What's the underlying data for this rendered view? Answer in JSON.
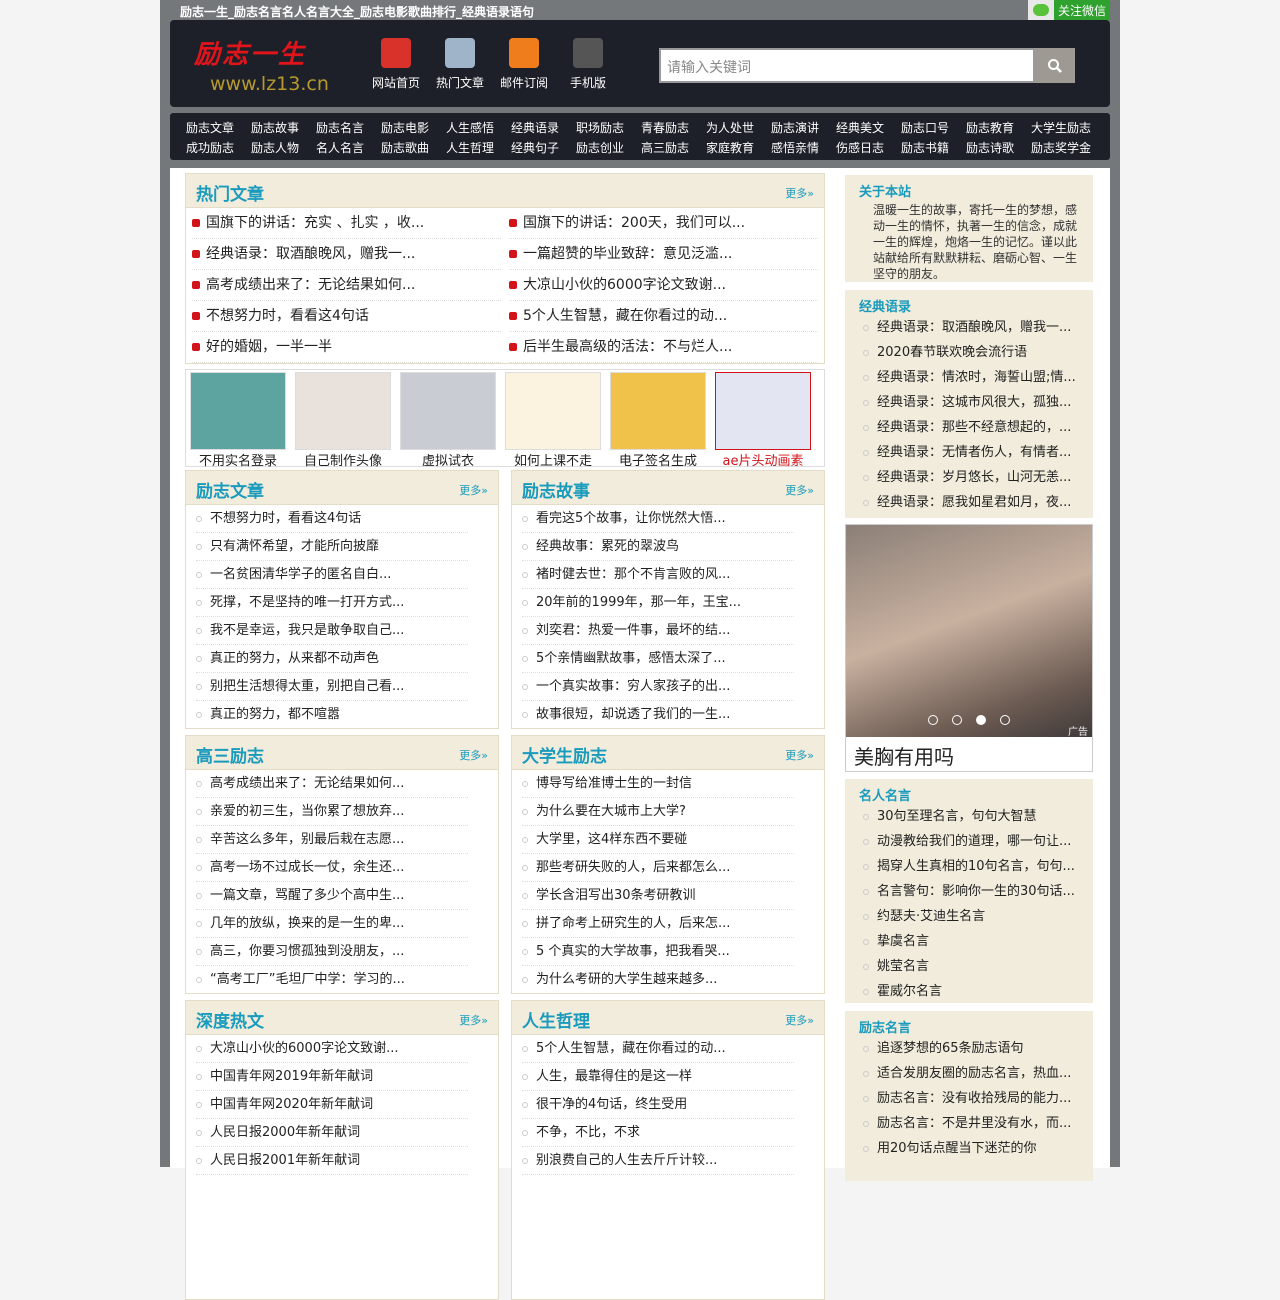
{
  "site_title": "励志一生_励志名言名人名言大全_励志电影歌曲排行_经典语录语句",
  "wechat": "关注微信",
  "logo": {
    "cn": "励志一生",
    "url": "www.lz13.cn"
  },
  "header_nav": [
    {
      "label": "网站首页",
      "icon": "home-icon",
      "color": "#d8322a"
    },
    {
      "label": "热门文章",
      "icon": "document-globe-icon",
      "color": "#9fb4c8"
    },
    {
      "label": "邮件订阅",
      "icon": "rss-icon",
      "color": "#f07d1c"
    },
    {
      "label": "手机版",
      "icon": "mobile-phone-icon",
      "color": "#555"
    }
  ],
  "search": {
    "placeholder": "请输入关键词"
  },
  "nav": [
    [
      "励志文章",
      "励志故事",
      "励志名言",
      "励志电影",
      "人生感悟",
      "经典语录",
      "职场励志",
      "青春励志",
      "为人处世",
      "励志演讲",
      "经典美文",
      "励志口号",
      "励志教育",
      "大学生励志"
    ],
    [
      "成功励志",
      "励志人物",
      "名人名言",
      "励志歌曲",
      "人生哲理",
      "经典句子",
      "励志创业",
      "高三励志",
      "家庭教育",
      "感悟亲情",
      "伤感日志",
      "励志书籍",
      "励志诗歌",
      "励志奖学金"
    ]
  ],
  "more": "更多»",
  "hot": {
    "title": "热门文章",
    "items": [
      "国旗下的讲话：充实 、扎实 ，收...",
      "国旗下的讲话：200天，我们可以...",
      "经典语录：取酒酿晚风，赠我一...",
      "一篇超赞的毕业致辞：意见泛滥...",
      "高考成绩出来了：无论结果如何...",
      "大凉山小伙的6000字论文致谢...",
      "不想努力时，看看这4句话",
      "5个人生智慧，藏在你看过的动...",
      "好的婚姻，一半一半",
      "后半生最高级的活法：不与烂人..."
    ]
  },
  "thumbs": [
    {
      "label": "不用实名登录",
      "color": "#5da3a0"
    },
    {
      "label": "自己制作头像",
      "color": "#e9e2dc"
    },
    {
      "label": "虚拟试衣",
      "color": "#c9cdd3"
    },
    {
      "label": "如何上课不走",
      "color": "#fbf3df"
    },
    {
      "label": "电子签名生成",
      "color": "#f0c24a"
    },
    {
      "label": "ae片头动画素",
      "color": "#e3e6f2"
    }
  ],
  "sections": [
    {
      "title": "励志文章",
      "items": [
        "不想努力时，看看这4句话",
        "只有满怀希望，才能所向披靡",
        "一名贫困清华学子的匿名自白...",
        "死撑，不是坚持的唯一打开方式...",
        "我不是幸运，我只是敢争取自己...",
        "真正的努力，从来都不动声色",
        "别把生活想得太重，别把自己看...",
        "真正的努力，都不喧嚣"
      ]
    },
    {
      "title": "励志故事",
      "items": [
        "看完这5个故事，让你恍然大悟...",
        "经典故事：累死的翠波鸟",
        "褚时健去世：那个不肯言败的风...",
        "20年前的1999年，那一年，王宝...",
        "刘奕君：热爱一件事，最坏的结...",
        "5个亲情幽默故事，感悟太深了...",
        "一个真实故事：穷人家孩子的出...",
        "故事很短，却说透了我们的一生..."
      ]
    },
    {
      "title": "高三励志",
      "items": [
        "高考成绩出来了：无论结果如何...",
        "亲爱的初三生，当你累了想放弃...",
        "辛苦这么多年，别最后栽在志愿...",
        "高考一场不过成长一仗，余生还...",
        "一篇文章，骂醒了多少个高中生...",
        "几年的放纵，换来的是一生的卑...",
        "高三，你要习惯孤独到没朋友，...",
        "“高考工厂”毛坦厂中学：学习的..."
      ]
    },
    {
      "title": "大学生励志",
      "items": [
        "博导写给准博士生的一封信",
        "为什么要在大城市上大学?",
        "大学里，这4样东西不要碰",
        "那些考研失败的人，后来都怎么...",
        "学长含泪写出30条考研教训",
        "拼了命考上研究生的人，后来怎...",
        "5 个真实的大学故事，把我看哭...",
        "为什么考研的大学生越来越多..."
      ]
    },
    {
      "title": "深度热文",
      "items": [
        "大凉山小伙的6000字论文致谢...",
        "中国青年网2019年新年献词",
        "中国青年网2020年新年献词",
        "人民日报2000年新年献词",
        "人民日报2001年新年献词"
      ]
    },
    {
      "title": "人生哲理",
      "items": [
        "5个人生智慧，藏在你看过的动...",
        "人生，最靠得住的是这一样",
        "很干净的4句话，终生受用",
        "不争，不比，不求",
        "别浪费自己的人生去斤斤计较..."
      ]
    }
  ],
  "about": {
    "title": "关于本站",
    "text": "温暖一生的故事，寄托一生的梦想，感动一生的情怀，执著一生的信念，成就一生的辉煌，炮烙一生的记忆。谨以此站献给所有默默耕耘、磨砺心智、一生坚守的朋友。"
  },
  "side_quotes": {
    "title": "经典语录",
    "items": [
      "经典语录：取酒酿晚风，赠我一...",
      "2020春节联欢晚会流行语",
      "经典语录：情浓时，海誓山盟;情...",
      "经典语录：这城市风很大，孤独...",
      "经典语录：那些不经意想起的，...",
      "经典语录：无情者伤人，有情者...",
      "经典语录：岁月悠长，山河无恙...",
      "经典语录：愿我如星君如月，夜..."
    ]
  },
  "ad": {
    "caption": "美胸有用吗",
    "tag": "广告",
    "slides": 4,
    "active_slide": 3
  },
  "side_famous": {
    "title": "名人名言",
    "items": [
      "30句至理名言，句句大智慧",
      "动漫教给我们的道理，哪一句让...",
      "揭穿人生真相的10句名言，句句...",
      "名言警句：影响你一生的30句话...",
      "约瑟夫·艾迪生名言",
      "挚虞名言",
      "姚莹名言",
      "霍威尔名言"
    ]
  },
  "side_motto": {
    "title": "励志名言",
    "items": [
      "追逐梦想的65条励志语句",
      "适合发朋友圈的励志名言，热血...",
      "励志名言：没有收拾残局的能力...",
      "励志名言：不是井里没有水，而...",
      "用20句话点醒当下迷茫的你"
    ]
  }
}
